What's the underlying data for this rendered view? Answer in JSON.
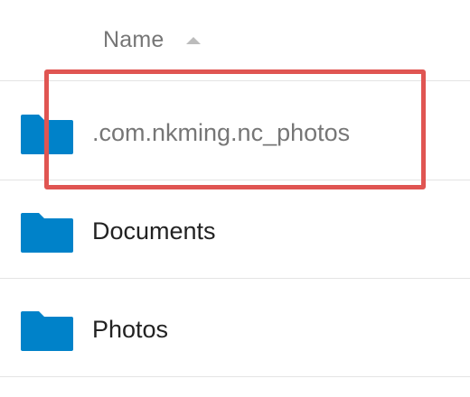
{
  "header": {
    "sort_column_label": "Name",
    "sort_direction": "ascending"
  },
  "files": [
    {
      "name": ".com.nkming.nc_photos",
      "type": "folder",
      "icon": "folder-icon",
      "hidden": true,
      "highlighted": true
    },
    {
      "name": "Documents",
      "type": "folder",
      "icon": "folder-icon",
      "hidden": false,
      "highlighted": false
    },
    {
      "name": "Photos",
      "type": "folder",
      "icon": "folder-icon",
      "hidden": false,
      "highlighted": false
    }
  ],
  "colors": {
    "folder_icon": "#0082c9",
    "highlight_box": "#e05552",
    "header_text": "#767676",
    "hidden_entry_text": "#767676",
    "entry_text": "#222222",
    "divider": "#e4e4e4"
  }
}
